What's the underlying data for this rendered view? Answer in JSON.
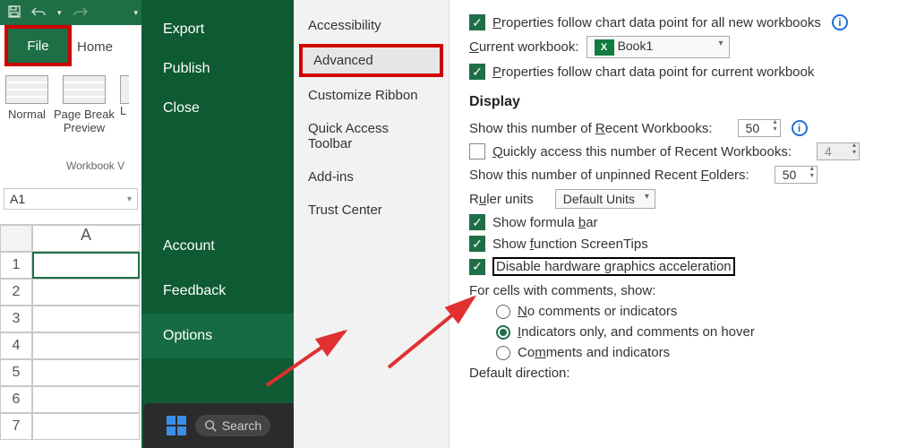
{
  "qat": {
    "save_title": "Save",
    "undo_title": "Undo",
    "redo_title": "Redo"
  },
  "ribbon": {
    "file_tab": "File",
    "home_tab": "Home",
    "view_normal": "Normal",
    "view_pagebreak_line1": "Page Break",
    "view_pagebreak_line2": "Preview",
    "layout_initial": "L",
    "group_label": "Workbook V"
  },
  "namebox": "A1",
  "sheet": {
    "col": "A",
    "rows": [
      "1",
      "2",
      "3",
      "4",
      "5",
      "6",
      "7"
    ]
  },
  "backstage": {
    "top": [
      "Export",
      "Publish",
      "Close"
    ],
    "bottom": [
      "Account",
      "Feedback",
      "Options"
    ],
    "active": "Options"
  },
  "taskbar": {
    "search_label": "Search"
  },
  "option_categories": [
    "Accessibility",
    "Advanced",
    "Customize Ribbon",
    "Quick Access Toolbar",
    "Add-ins",
    "Trust Center"
  ],
  "option_active": "Advanced",
  "pane": {
    "prop_all": "roperties follow chart data point for all new workbooks",
    "prop_all_u": "P",
    "cwb_label_u": "C",
    "cwb_label": "urrent workbook:",
    "cwb_value": "Book1",
    "prop_cur_u": "P",
    "prop_cur": "roperties follow chart data point for current workbook",
    "section": "Display",
    "recent_wb_pre": "Show this number of ",
    "recent_wb_u": "R",
    "recent_wb_post": "ecent Workbooks:",
    "recent_wb_val": "50",
    "quick_access_u": "Q",
    "quick_access": "uickly access this number of Recent Workbooks:",
    "quick_access_val": "4",
    "recent_folders_pre": "Show this number of unpinned Recent ",
    "recent_folders_u": "F",
    "recent_folders_post": "olders:",
    "recent_folders_val": "50",
    "ruler_pre": "R",
    "ruler_u": "u",
    "ruler_post": "ler units",
    "ruler_val": "Default Units",
    "formula_bar_pre": "Show formula ",
    "formula_bar_u": "b",
    "formula_bar_post": "ar",
    "screentips_pre": "Show ",
    "screentips_u": "f",
    "screentips_post": "unction ScreenTips",
    "disable_hw_pre": "Disable hardware ",
    "disable_hw_u": "g",
    "disable_hw_post": "raphics acceleration",
    "comments_label": "For cells with comments, show:",
    "c1_u": "N",
    "c1": "o comments or indicators",
    "c2_u": "I",
    "c2": "ndicators only, and comments on hover",
    "c3_pre": "Co",
    "c3_u": "m",
    "c3_post": "ments and indicators",
    "default_dir": "Default direction:"
  }
}
